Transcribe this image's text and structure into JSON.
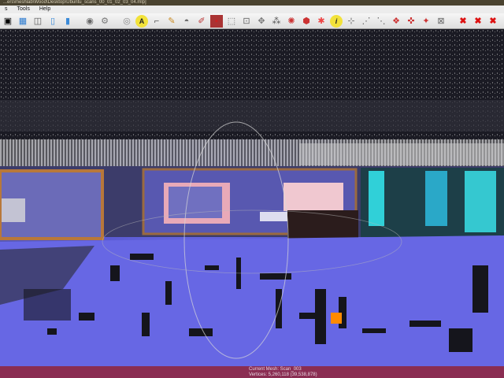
{
  "window": {
    "title": "...ers\\meshlab\\Wood\\Desktop\\Ubuntu_scans_00_01_02_03_04.mlp]"
  },
  "menu": {
    "items": [
      "s",
      "Tools",
      "Help"
    ]
  },
  "toolbar": {
    "icons": [
      "open-icon",
      "layers-icon",
      "snapshot-icon",
      "points-icon",
      "wire-icon",
      "flat-icon",
      "smooth-icon",
      "cube-icon",
      "texture-icon",
      "annotate-icon",
      "pointer-icon",
      "paint-icon",
      "colorize-icon",
      "shader-icon",
      "select-icon",
      "select-faces-icon",
      "vertex-icon",
      "label-icon",
      "info-icon",
      "select-area-icon",
      "select-connected-icon",
      "pick-icon",
      "move-icon",
      "align-icon",
      "delete-icon",
      "delete-faces-icon",
      "delete-vertices-icon"
    ]
  },
  "viewport": {
    "description_color": "#6f6ff2"
  },
  "status": {
    "current_mesh": "Current Mesh: Scan_003",
    "vertices": "Vertices: 5,260,118     (39,538,878)"
  },
  "colors": {
    "floor": "#6f6ff2",
    "statusbar": "#8a2d52",
    "toolbar": "#e6e6e6"
  }
}
